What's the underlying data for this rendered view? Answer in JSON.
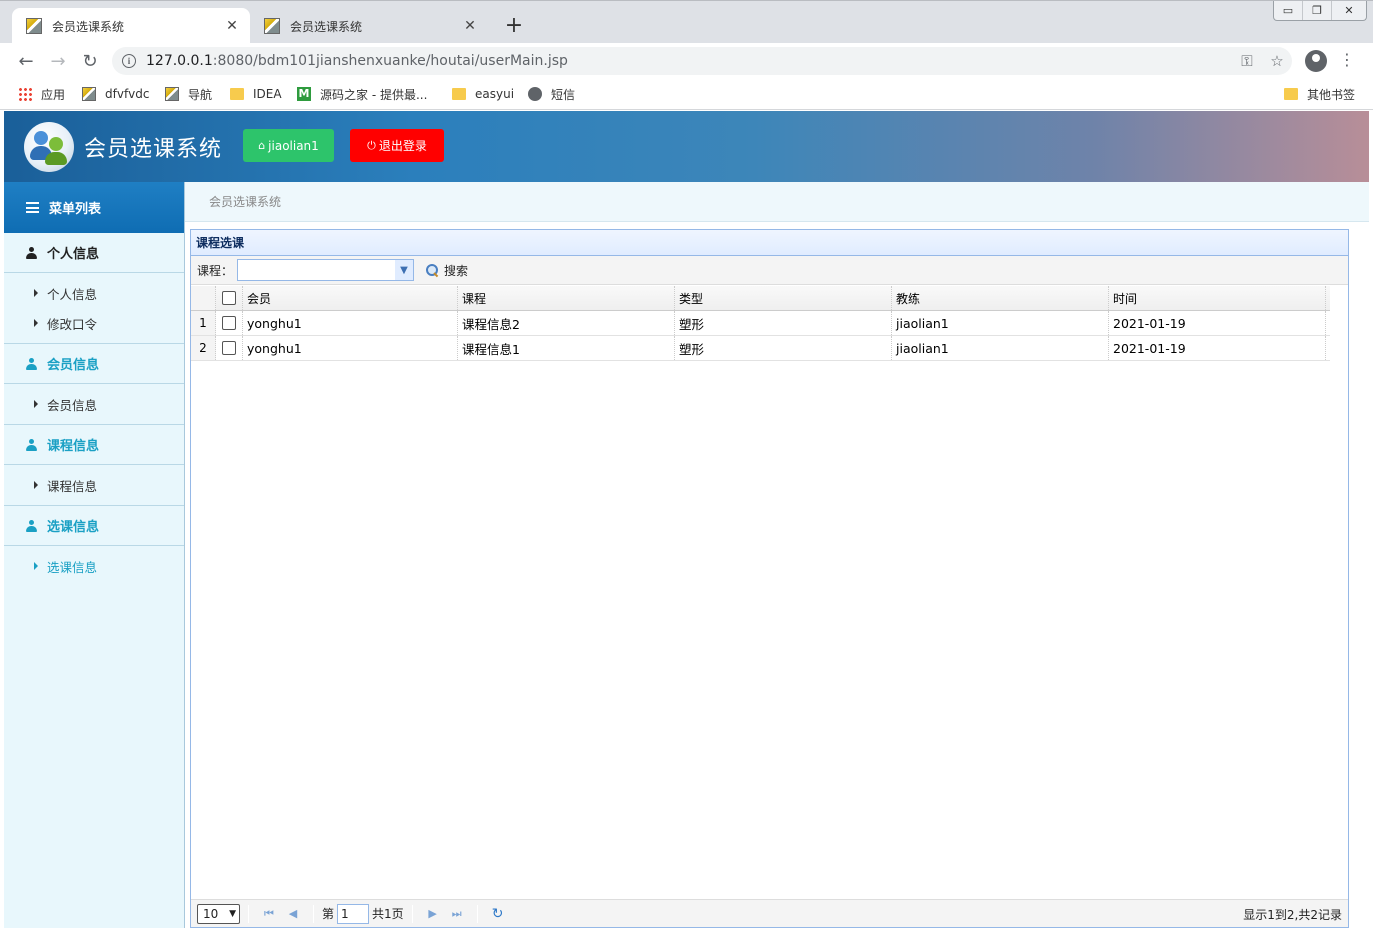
{
  "browser": {
    "tabs": [
      {
        "title": "会员选课系统",
        "close": "✕"
      },
      {
        "title": "会员选课系统",
        "close": "✕"
      }
    ],
    "new_tab": "+",
    "url_host": "127.0.0.1",
    "url_rest": ":8080/bdm101jianshenxuanke/houtai/userMain.jsp",
    "bookmarks": [
      {
        "label": "应用",
        "icon": "apps-icon"
      },
      {
        "label": "dfvfvdc",
        "icon": "page-icon"
      },
      {
        "label": "导航",
        "icon": "page-icon"
      },
      {
        "label": "IDEA",
        "icon": "folder-icon"
      },
      {
        "label": "源码之家 - 提供最...",
        "icon": "m-logo-icon"
      },
      {
        "label": "easyui",
        "icon": "folder-icon"
      },
      {
        "label": "短信",
        "icon": "globe-icon"
      }
    ],
    "other_bookmarks": "其他书签"
  },
  "header": {
    "title": "会员选课系统",
    "user_label": "jiaolian1",
    "logout_label": "退出登录"
  },
  "sidebar": {
    "menu_title": "菜单列表",
    "groups": [
      {
        "label": "个人信息",
        "items": [
          "个人信息",
          "修改口令"
        ]
      },
      {
        "label": "会员信息",
        "items": [
          "会员信息"
        ]
      },
      {
        "label": "课程信息",
        "items": [
          "课程信息"
        ]
      },
      {
        "label": "选课信息",
        "items": [
          "选课信息"
        ]
      }
    ]
  },
  "breadcrumb": "会员选课系统",
  "panel": {
    "title": "课程选课",
    "filter_label": "课程：",
    "filter_value": "",
    "search_label": "搜索"
  },
  "table": {
    "columns": [
      "会员",
      "课程",
      "类型",
      "教练",
      "时间"
    ],
    "rows": [
      {
        "num": "1",
        "member": "yonghu1",
        "course": "课程信息2",
        "type": "塑形",
        "coach": "jiaolian1",
        "time": "2021-01-19"
      },
      {
        "num": "2",
        "member": "yonghu1",
        "course": "课程信息1",
        "type": "塑形",
        "coach": "jiaolian1",
        "time": "2021-01-19"
      }
    ]
  },
  "pager": {
    "page_size": "10",
    "page_prefix": "第",
    "page_number": "1",
    "page_total": "共1页",
    "info": "显示1到2,共2记录"
  },
  "colors": {
    "user_button": "#2dc46b",
    "logout_button": "#ff0000",
    "sidebar_accent": "#1aa0c4",
    "menu_title_bg": "#0f6db3"
  }
}
